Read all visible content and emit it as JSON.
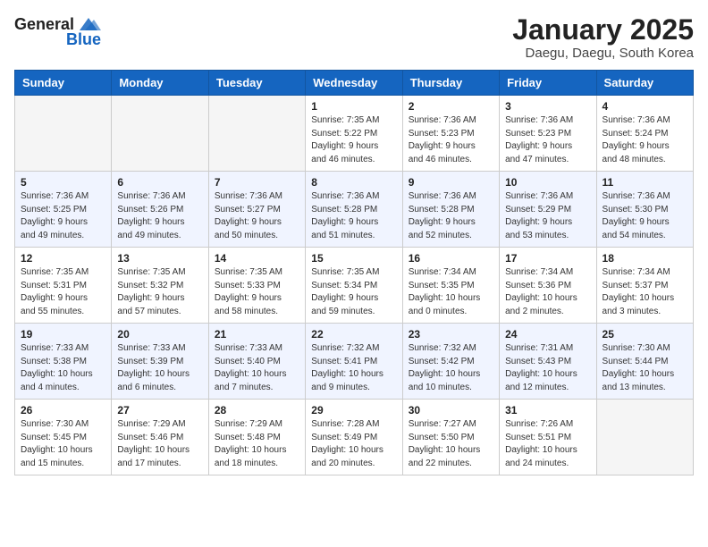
{
  "header": {
    "logo_line1": "General",
    "logo_line2": "Blue",
    "month": "January 2025",
    "location": "Daegu, Daegu, South Korea"
  },
  "weekdays": [
    "Sunday",
    "Monday",
    "Tuesday",
    "Wednesday",
    "Thursday",
    "Friday",
    "Saturday"
  ],
  "weeks": [
    [
      {
        "day": "",
        "info": ""
      },
      {
        "day": "",
        "info": ""
      },
      {
        "day": "",
        "info": ""
      },
      {
        "day": "1",
        "info": "Sunrise: 7:35 AM\nSunset: 5:22 PM\nDaylight: 9 hours\nand 46 minutes."
      },
      {
        "day": "2",
        "info": "Sunrise: 7:36 AM\nSunset: 5:23 PM\nDaylight: 9 hours\nand 46 minutes."
      },
      {
        "day": "3",
        "info": "Sunrise: 7:36 AM\nSunset: 5:23 PM\nDaylight: 9 hours\nand 47 minutes."
      },
      {
        "day": "4",
        "info": "Sunrise: 7:36 AM\nSunset: 5:24 PM\nDaylight: 9 hours\nand 48 minutes."
      }
    ],
    [
      {
        "day": "5",
        "info": "Sunrise: 7:36 AM\nSunset: 5:25 PM\nDaylight: 9 hours\nand 49 minutes."
      },
      {
        "day": "6",
        "info": "Sunrise: 7:36 AM\nSunset: 5:26 PM\nDaylight: 9 hours\nand 49 minutes."
      },
      {
        "day": "7",
        "info": "Sunrise: 7:36 AM\nSunset: 5:27 PM\nDaylight: 9 hours\nand 50 minutes."
      },
      {
        "day": "8",
        "info": "Sunrise: 7:36 AM\nSunset: 5:28 PM\nDaylight: 9 hours\nand 51 minutes."
      },
      {
        "day": "9",
        "info": "Sunrise: 7:36 AM\nSunset: 5:28 PM\nDaylight: 9 hours\nand 52 minutes."
      },
      {
        "day": "10",
        "info": "Sunrise: 7:36 AM\nSunset: 5:29 PM\nDaylight: 9 hours\nand 53 minutes."
      },
      {
        "day": "11",
        "info": "Sunrise: 7:36 AM\nSunset: 5:30 PM\nDaylight: 9 hours\nand 54 minutes."
      }
    ],
    [
      {
        "day": "12",
        "info": "Sunrise: 7:35 AM\nSunset: 5:31 PM\nDaylight: 9 hours\nand 55 minutes."
      },
      {
        "day": "13",
        "info": "Sunrise: 7:35 AM\nSunset: 5:32 PM\nDaylight: 9 hours\nand 57 minutes."
      },
      {
        "day": "14",
        "info": "Sunrise: 7:35 AM\nSunset: 5:33 PM\nDaylight: 9 hours\nand 58 minutes."
      },
      {
        "day": "15",
        "info": "Sunrise: 7:35 AM\nSunset: 5:34 PM\nDaylight: 9 hours\nand 59 minutes."
      },
      {
        "day": "16",
        "info": "Sunrise: 7:34 AM\nSunset: 5:35 PM\nDaylight: 10 hours\nand 0 minutes."
      },
      {
        "day": "17",
        "info": "Sunrise: 7:34 AM\nSunset: 5:36 PM\nDaylight: 10 hours\nand 2 minutes."
      },
      {
        "day": "18",
        "info": "Sunrise: 7:34 AM\nSunset: 5:37 PM\nDaylight: 10 hours\nand 3 minutes."
      }
    ],
    [
      {
        "day": "19",
        "info": "Sunrise: 7:33 AM\nSunset: 5:38 PM\nDaylight: 10 hours\nand 4 minutes."
      },
      {
        "day": "20",
        "info": "Sunrise: 7:33 AM\nSunset: 5:39 PM\nDaylight: 10 hours\nand 6 minutes."
      },
      {
        "day": "21",
        "info": "Sunrise: 7:33 AM\nSunset: 5:40 PM\nDaylight: 10 hours\nand 7 minutes."
      },
      {
        "day": "22",
        "info": "Sunrise: 7:32 AM\nSunset: 5:41 PM\nDaylight: 10 hours\nand 9 minutes."
      },
      {
        "day": "23",
        "info": "Sunrise: 7:32 AM\nSunset: 5:42 PM\nDaylight: 10 hours\nand 10 minutes."
      },
      {
        "day": "24",
        "info": "Sunrise: 7:31 AM\nSunset: 5:43 PM\nDaylight: 10 hours\nand 12 minutes."
      },
      {
        "day": "25",
        "info": "Sunrise: 7:30 AM\nSunset: 5:44 PM\nDaylight: 10 hours\nand 13 minutes."
      }
    ],
    [
      {
        "day": "26",
        "info": "Sunrise: 7:30 AM\nSunset: 5:45 PM\nDaylight: 10 hours\nand 15 minutes."
      },
      {
        "day": "27",
        "info": "Sunrise: 7:29 AM\nSunset: 5:46 PM\nDaylight: 10 hours\nand 17 minutes."
      },
      {
        "day": "28",
        "info": "Sunrise: 7:29 AM\nSunset: 5:48 PM\nDaylight: 10 hours\nand 18 minutes."
      },
      {
        "day": "29",
        "info": "Sunrise: 7:28 AM\nSunset: 5:49 PM\nDaylight: 10 hours\nand 20 minutes."
      },
      {
        "day": "30",
        "info": "Sunrise: 7:27 AM\nSunset: 5:50 PM\nDaylight: 10 hours\nand 22 minutes."
      },
      {
        "day": "31",
        "info": "Sunrise: 7:26 AM\nSunset: 5:51 PM\nDaylight: 10 hours\nand 24 minutes."
      },
      {
        "day": "",
        "info": ""
      }
    ]
  ]
}
